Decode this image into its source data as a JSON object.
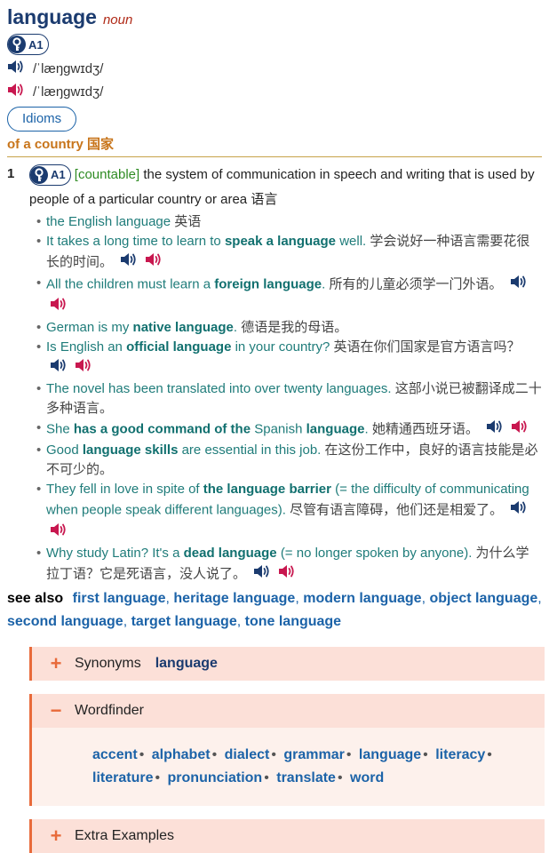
{
  "entry": {
    "headword": "language",
    "pos": "noun",
    "cefr": "A1",
    "pron_uk": "/ˈlæŋɡwɪdʒ/",
    "pron_us": "/ˈlæŋɡwɪdʒ/",
    "idioms_button": "Idioms"
  },
  "colors": {
    "uk_audio": "#1b3b6f",
    "us_audio": "#c8174f",
    "box_accent": "#e86a3a"
  },
  "sense": {
    "heading": "of a country 国家",
    "number": "1",
    "cefr": "A1",
    "grammar": "[countable]",
    "definition": "the system of communication in speech and writing that is used by people of a particular country or area",
    "definition_zh": "语言",
    "examples": {
      "e1": {
        "text": "the English language",
        "zh": "英语"
      },
      "e2": {
        "a": "It takes a long time to learn to",
        "b": "speak a language",
        "c": "well.",
        "zh": "学会说好一种语言需要花很长的时间。"
      },
      "e3": {
        "a": "All the children must learn a",
        "b": "foreign language",
        "c": ".",
        "zh": "所有的儿童必须学一门外语。"
      },
      "e4": {
        "a": "German is my",
        "b": "native language",
        "c": ".",
        "zh": "德语是我的母语。"
      },
      "e5": {
        "a": "Is English an",
        "b": "official language",
        "c": "in your country?",
        "zh": "英语在你们国家是官方语言吗？"
      },
      "e6": {
        "text": "The novel has been translated into over twenty languages.",
        "zh": "这部小说已被翻译成二十多种语言。"
      },
      "e7": {
        "a": "She",
        "b": "has a good command of the",
        "c": "Spanish",
        "d": "language",
        "e": ".",
        "zh": "她精通西班牙语。"
      },
      "e8": {
        "a": "Good",
        "b": "language skills",
        "c": "are essential in this job.",
        "zh": "在这份工作中，良好的语言技能是必不可少的。"
      },
      "e9": {
        "a": "They fell in love in spite of",
        "b": "the language barrier",
        "c": "(= the difficulty of communicating when people speak different languages).",
        "zh": "尽管有语言障碍，他们还是相爱了。"
      },
      "e10": {
        "a": "Why study Latin? It's a",
        "b": "dead language",
        "c": "(= no longer spoken by anyone).",
        "zh": "为什么学拉丁语？它是死语言，没人说了。"
      }
    }
  },
  "see_also": {
    "label": "see also",
    "links": [
      "first language",
      "heritage language",
      "modern language",
      "object language",
      "second language",
      "target language",
      "tone language"
    ]
  },
  "boxes": {
    "synonyms": {
      "sign": "+",
      "title": "Synonyms",
      "keyword": "language"
    },
    "wordfinder": {
      "sign": "−",
      "title": "Wordfinder",
      "words": [
        "accent",
        "alphabet",
        "dialect",
        "grammar",
        "language",
        "literacy",
        "literature",
        "pronunciation",
        "translate",
        "word"
      ]
    },
    "extra": {
      "sign": "+",
      "title": "Extra Examples"
    }
  }
}
